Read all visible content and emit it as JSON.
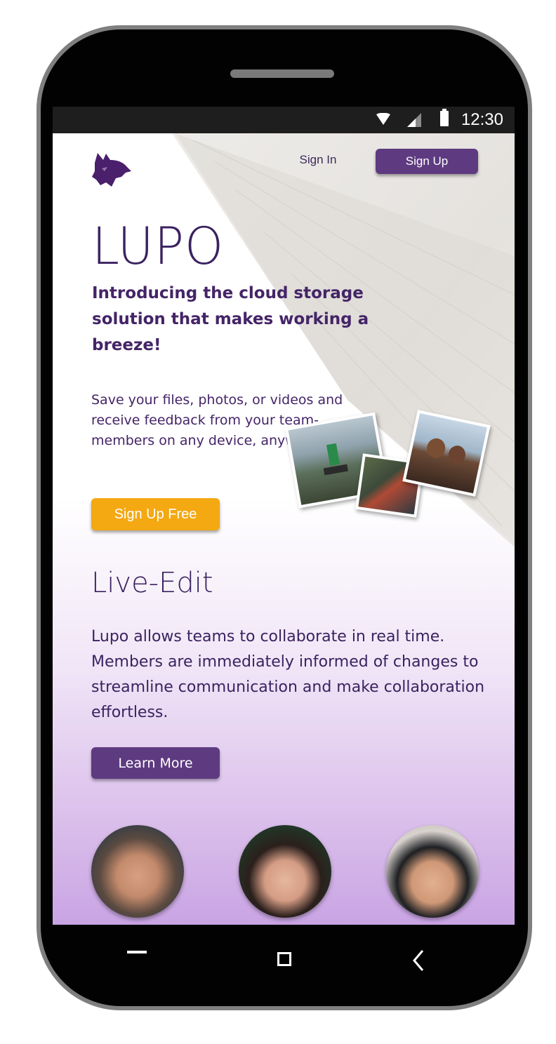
{
  "status_bar": {
    "time": "12:30",
    "icons": [
      "wifi-icon",
      "signal-icon",
      "battery-icon"
    ]
  },
  "header": {
    "logo": "wolf-logo",
    "sign_in": "Sign In",
    "sign_up": "Sign Up"
  },
  "hero": {
    "title": "LUPO",
    "headline": "Introducing the cloud storage solution that makes working a breeze!",
    "lead": "Save your files, photos, or videos and receive feedback from your team-members on any device, anywhere.",
    "cta": "Sign Up Free"
  },
  "feature": {
    "title": "Live-Edit",
    "body": "Lupo allows teams to collaborate in real time. Members are immediately informed of changes to streamline communication and make collaboration effortless.",
    "button": "Learn More"
  },
  "team_avatars": [
    "avatar-man-beanie",
    "avatar-woman-hat",
    "avatar-man-cap"
  ],
  "colors": {
    "brand_purple": "#5e3a80",
    "text_purple": "#442467",
    "cta_orange": "#f4a812"
  },
  "nav_bar": [
    "recent-apps-icon",
    "home-icon",
    "back-icon"
  ]
}
